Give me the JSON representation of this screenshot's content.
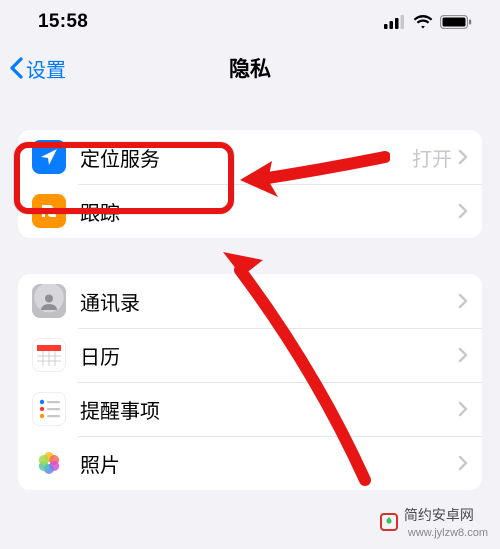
{
  "status": {
    "time": "15:58"
  },
  "nav": {
    "back_label": "设置",
    "title": "隐私"
  },
  "group1": {
    "items": [
      {
        "label": "定位服务",
        "detail": "打开",
        "icon": "location-icon"
      },
      {
        "label": "跟踪",
        "detail": "",
        "icon": "tracking-icon"
      }
    ]
  },
  "group2": {
    "items": [
      {
        "label": "通讯录",
        "icon": "contacts-icon"
      },
      {
        "label": "日历",
        "icon": "calendar-icon"
      },
      {
        "label": "提醒事项",
        "icon": "reminders-icon"
      },
      {
        "label": "照片",
        "icon": "photos-icon"
      }
    ]
  },
  "watermark": {
    "text": "简约安卓网",
    "url": "www.jylzw8.com"
  }
}
